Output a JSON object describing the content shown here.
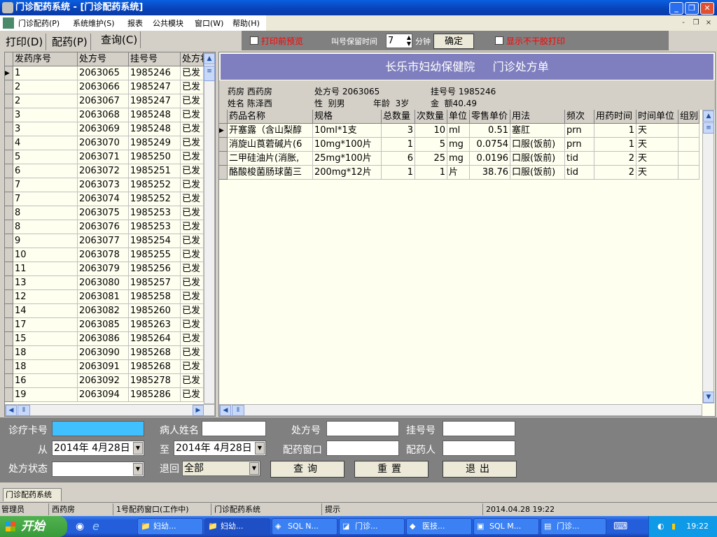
{
  "window": {
    "title": "门诊配药系统 - [门诊配药系统]",
    "min": "_",
    "restore": "❐",
    "close": "✕"
  },
  "menu": [
    "门诊配药(P)",
    "系统维护(S)",
    "报表",
    "公共模块",
    "窗口(W)",
    "帮助(H)"
  ],
  "mdi": {
    "min": "-",
    "restore": "❐",
    "close": "×"
  },
  "tabs": [
    "打印(D)",
    "配药(P)",
    "查询(C)"
  ],
  "toolbar": {
    "preview_label": "打印前预览",
    "hold_label": "叫号保留时间",
    "hold_value": "7",
    "unit": "分钟",
    "ok": "确定",
    "noglue_label": "显示不干胶打印"
  },
  "left_grid": {
    "columns": [
      "发药序号",
      "处方号",
      "挂号号",
      "处方状态"
    ],
    "rows": [
      [
        "1",
        "2063065",
        "1985246",
        "已发"
      ],
      [
        "2",
        "2063066",
        "1985247",
        "已发"
      ],
      [
        "2",
        "2063067",
        "1985247",
        "已发"
      ],
      [
        "3",
        "2063068",
        "1985248",
        "已发"
      ],
      [
        "3",
        "2063069",
        "1985248",
        "已发"
      ],
      [
        "4",
        "2063070",
        "1985249",
        "已发"
      ],
      [
        "5",
        "2063071",
        "1985250",
        "已发"
      ],
      [
        "6",
        "2063072",
        "1985251",
        "已发"
      ],
      [
        "7",
        "2063073",
        "1985252",
        "已发"
      ],
      [
        "7",
        "2063074",
        "1985252",
        "已发"
      ],
      [
        "8",
        "2063075",
        "1985253",
        "已发"
      ],
      [
        "8",
        "2063076",
        "1985253",
        "已发"
      ],
      [
        "9",
        "2063077",
        "1985254",
        "已发"
      ],
      [
        "10",
        "2063078",
        "1985255",
        "已发"
      ],
      [
        "11",
        "2063079",
        "1985256",
        "已发"
      ],
      [
        "13",
        "2063080",
        "1985257",
        "已发"
      ],
      [
        "12",
        "2063081",
        "1985258",
        "已发"
      ],
      [
        "14",
        "2063082",
        "1985260",
        "已发"
      ],
      [
        "17",
        "2063085",
        "1985263",
        "已发"
      ],
      [
        "15",
        "2063086",
        "1985264",
        "已发"
      ],
      [
        "18",
        "2063090",
        "1985268",
        "已发"
      ],
      [
        "18",
        "2063091",
        "1985268",
        "已发"
      ],
      [
        "16",
        "2063092",
        "1985278",
        "已发"
      ],
      [
        "19",
        "2063094",
        "1985286",
        "已发"
      ]
    ]
  },
  "prescription": {
    "hospital": "长乐市妇幼保健院",
    "title": "门诊处方单",
    "pharmacy": "药房 西药房",
    "rx_no": "处方号 2063065",
    "reg_no": "挂号号 1985246",
    "name": "姓名 陈泽西",
    "sex": "性  别男",
    "age": "年龄  3岁",
    "amount": "金  额40.49",
    "columns": [
      "药品名称",
      "规格",
      "总数量",
      "次数量",
      "单位",
      "零售单价",
      "用法",
      "频次",
      "用药时间",
      "时间单位",
      "组别"
    ],
    "rows": [
      [
        "开塞露（含山梨醇",
        "10ml*1支",
        "3",
        "10",
        "ml",
        "0.51",
        "塞肛",
        "prn",
        "1",
        "天",
        ""
      ],
      [
        "消旋山莨菪碱片(6",
        "10mg*100片",
        "1",
        "5",
        "mg",
        "0.0754",
        "口服(饭前)",
        "prn",
        "1",
        "天",
        ""
      ],
      [
        "二甲硅油片(消胀,",
        "25mg*100片",
        "6",
        "25",
        "mg",
        "0.0196",
        "口服(饭前)",
        "tid",
        "2",
        "天",
        ""
      ],
      [
        "酪酸梭菌肠球菌三",
        "200mg*12片",
        "1",
        "1",
        "片",
        "38.76",
        "口服(饭前)",
        "tid",
        "2",
        "天",
        ""
      ]
    ]
  },
  "filter": {
    "card_label": "诊疗卡号",
    "card_value": "",
    "patient_label": "病人姓名",
    "patient_value": "",
    "rx_label": "处方号",
    "rx_value": "",
    "reg_label": "挂号号",
    "reg_value": "",
    "from_label": "从",
    "from_value": "2014年 4月28日",
    "to_label": "至",
    "to_value": "2014年 4月28日",
    "window_label": "配药窗口",
    "window_value": "",
    "dispenser_label": "配药人",
    "dispenser_value": "",
    "status_label": "处方状态",
    "status_value": "",
    "return_label": "退回",
    "return_value": "全部",
    "query": "查询",
    "reset": "重置",
    "exit": "退出"
  },
  "doc_tab": "门诊配药系统",
  "status": [
    "管理员",
    "西药房",
    "1号配药窗口(工作中)",
    "门诊配药系统",
    "提示",
    "2014.04.28 19:22"
  ],
  "taskbar": {
    "start": "开始",
    "tasks": [
      "妇幼...",
      "妇幼...",
      "SQL N...",
      "门诊...",
      "医技...",
      "SQL M...",
      "门诊..."
    ],
    "clock": "19:22"
  },
  "colors": {
    "title_bar": "#0842b8",
    "banner": "#7f7fbf",
    "grid_bg": "#fffff0",
    "panel": "#808080",
    "card_field": "#40c0ff",
    "warning_text": "#ff0000"
  }
}
